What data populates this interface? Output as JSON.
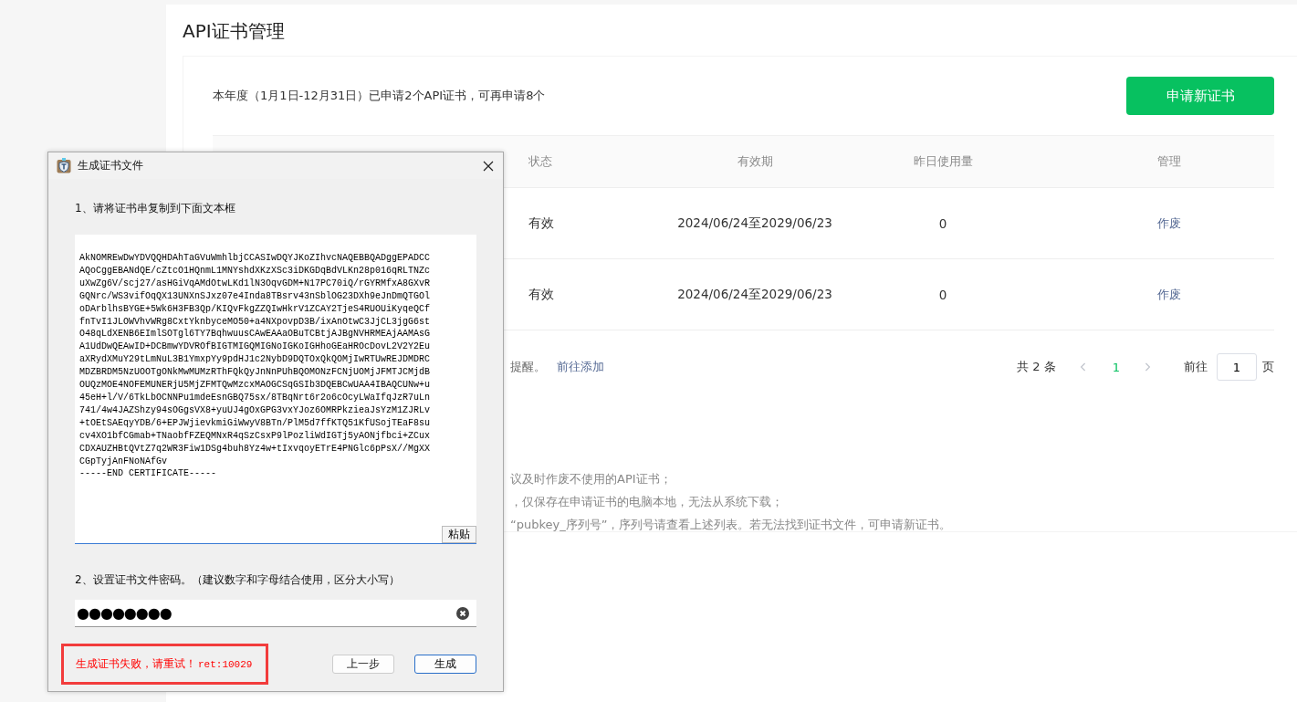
{
  "page": {
    "title": "API证书管理",
    "quota_text": "本年度（1月1日-12月31日）已申请2个API证书，可再申请8个",
    "apply_button": "申请新证书"
  },
  "table": {
    "columns": [
      "状态",
      "有效期",
      "昨日使用量",
      "管理"
    ],
    "rows": [
      {
        "status": "有效",
        "validity": "2024/06/24至2029/06/23",
        "usage": "0",
        "action": "作废"
      },
      {
        "status": "有效",
        "validity": "2024/06/24至2029/06/23",
        "usage": "0",
        "action": "作废"
      }
    ]
  },
  "reminder": {
    "text": "提醒。",
    "link": "前往添加"
  },
  "pagination": {
    "total": "共 2 条",
    "pages": [
      {
        "label": "1",
        "selected": true
      }
    ],
    "goto_label": "前往",
    "goto_value": "1",
    "page_suffix": "页"
  },
  "notes": [
    "议及时作废不使用的API证书；",
    "，仅保存在申请证书的电脑本地，无法从系统下载；",
    "“pubkey_序列号”，序列号请查看上述列表。若无法找到证书文件，可申请新证书。"
  ],
  "dialog": {
    "title": "生成证书文件",
    "step1_label": "1、请将证书串复制到下面文本框",
    "certificate": "AkNOMREwDwYDVQQHDAhTaGVuWmhlbjCCASIwDQYJKoZIhvcNAQEBBQADggEPADCC\nAQoCggEBANdQE/cZtcO1HQnmL1MNYshdXKzXSc3iDKGDqBdVLKn28p016qRLTNZc\nuXwZg6V/scj27/asHGiVqAMdOtwLKd1lN3OqvGDM+N17PC70iQ/rGYRMfxA8GXvR\nGQNrc/WS3vifOqQX13UNXnSJxz07e4Inda8TBsrv43nSblOG23DXh9eJnDmQTGOl\noDArblhsBYGE+5Wk6H3FB3Qp/KIQvFkgZZQIwHkrV1ZCAY2TjeS4RUOUiKyqeQCf\nfnTvI1JLOWVhvWRg8CxtYknbyceMO50+a4NXpovpD3B/ixAnOtwC3JjCL3jgG6st\nO48qLdXENB6EImlSOTgl6TY7BqhwuusCAwEAAaOBuTCBtjAJBgNVHRMEAjAAMAsG\nA1UdDwQEAwID+DCBmwYDVROfBIGTMIGQMIGNoIGKoIGHhoGEaHROcDovL2V2Y2Eu\naXRydXMuY29tLmNuL3B1YmxpYy9pdHJ1c2NybD9DQTOxQkQOMjIwRTUwREJDMDRC\nMDZBRDM5NzUOOTgONkMwMUMzRThFQkQyJnNnPUhBQOMONzFCNjUOMjJFMTJCMjdB\nOUQzMOE4NOFEMUNERjU5MjZFMTQwMzcxMAOGCSqGSIb3DQEBCwUAA4IBAQCUNw+u\n45eH+l/V/6TkLbOCNNPu1mdeEsnGBQ75sx/8TBqNrt6r2o6cOcyLWaIfqJzR7uLn\n741/4w4JAZShzy94sOGgsVX8+yuUJ4gOxGPG3vxYJoz6OMRPkzieaJsYzM1ZJRLv\n+tOEtSAEqyYDB/6+EPJWjievkmiGiWwyV8BTn/PlM5d7ffKTQ51KfUSojTEaF8su\ncv4XO1bfCGmab+TNaobfFZEQMNxR4qSzCsxP9lPozliWdIGTj5yAONjfbci+ZCux\nCDXAUZHBtQVtZ7q2WR3Fiw1DSg4buh8Yz4w+tIxvqoyETrE4PNGlc6pPsX//MgXX\nCGpTyjAnFNoNAfGv\n-----END CERTIFICATE-----",
    "paste_button": "粘贴",
    "step2_label": "2、设置证书文件密码。（建议数字和字母结合使用，区分大小写）",
    "password_mask": "●●●●●●●●",
    "error": {
      "message": "生成证书失败，请重试！",
      "code": "ret:10029"
    },
    "buttons": [
      {
        "label": "上一步",
        "primary": false
      },
      {
        "label": "生成",
        "primary": true
      }
    ]
  }
}
